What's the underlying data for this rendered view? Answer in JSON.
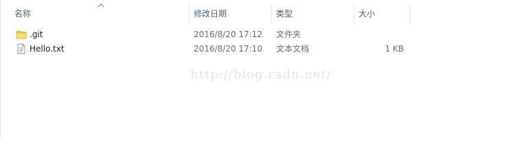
{
  "columns": {
    "name": "名称",
    "date": "修改日期",
    "type": "类型",
    "size": "大小"
  },
  "sort": {
    "column": "name",
    "direction": "ascending",
    "icon": "chevron-up-icon"
  },
  "files": [
    {
      "icon": "folder-icon",
      "name": ".git",
      "date": "2016/8/20 17:12",
      "type": "文件夹",
      "size": ""
    },
    {
      "icon": "text-file-icon",
      "name": "Hello.txt",
      "date": "2016/8/20 17:10",
      "type": "文本文档",
      "size": "1 KB"
    }
  ],
  "watermark": "http://blog.csdn.net/",
  "colors": {
    "header_text": "#4c607a",
    "folder_yellow": "#f3cf5b",
    "watermark": "#e3e3e3"
  }
}
